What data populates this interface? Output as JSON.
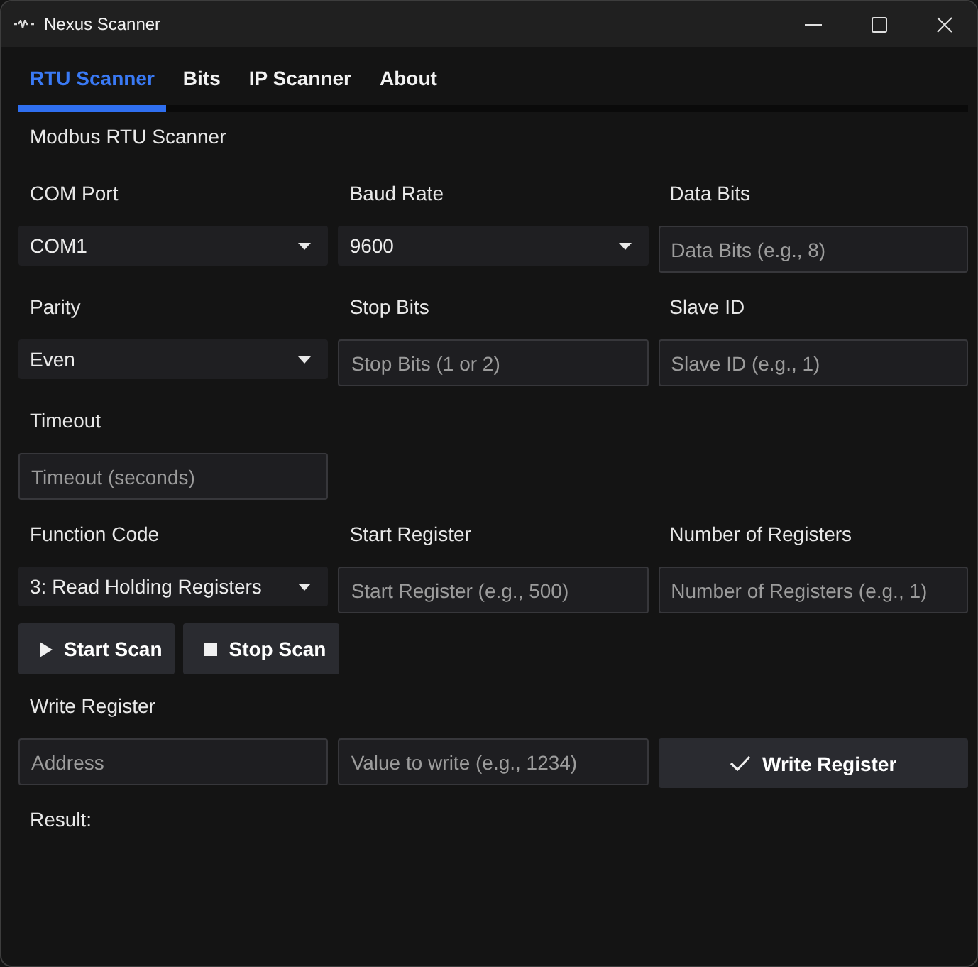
{
  "window": {
    "title": "Nexus Scanner"
  },
  "tabs": [
    {
      "label": "RTU Scanner",
      "selected": true
    },
    {
      "label": "Bits",
      "selected": false
    },
    {
      "label": "IP Scanner",
      "selected": false
    },
    {
      "label": "About",
      "selected": false
    }
  ],
  "heading": "Modbus RTU Scanner",
  "field_rows": [
    [
      {
        "kind": "dropdown",
        "label": "COM Port",
        "value": "COM1"
      },
      {
        "kind": "dropdown",
        "label": "Baud Rate",
        "value": "9600"
      },
      {
        "kind": "text",
        "label": "Data Bits",
        "placeholder": "Data Bits (e.g., 8)"
      }
    ],
    [
      {
        "kind": "dropdown",
        "label": "Parity",
        "value": "Even"
      },
      {
        "kind": "text",
        "label": "Stop Bits",
        "placeholder": "Stop Bits (1 or 2)"
      },
      {
        "kind": "text",
        "label": "Slave ID",
        "placeholder": "Slave ID (e.g., 1)"
      }
    ],
    [
      {
        "kind": "text",
        "label": "Timeout",
        "placeholder": "Timeout (seconds)"
      }
    ],
    [
      {
        "kind": "dropdown",
        "label": "Function Code",
        "value": "3: Read Holding Registers"
      },
      {
        "kind": "text",
        "label": "Start Register",
        "placeholder": "Start Register (e.g., 500)"
      },
      {
        "kind": "text",
        "label": "Number of Registers",
        "placeholder": "Number of Registers (e.g., 1)"
      }
    ]
  ],
  "scan_buttons": [
    {
      "kind": "start",
      "label": "Start Scan"
    },
    {
      "kind": "stop",
      "label": "Stop Scan"
    }
  ],
  "write_register": {
    "label": "Write Register",
    "fields": [
      {
        "placeholder": "Address"
      },
      {
        "placeholder": "Value to write (e.g., 1234)"
      }
    ],
    "button": "Write Register"
  },
  "result_label": "Result:"
}
